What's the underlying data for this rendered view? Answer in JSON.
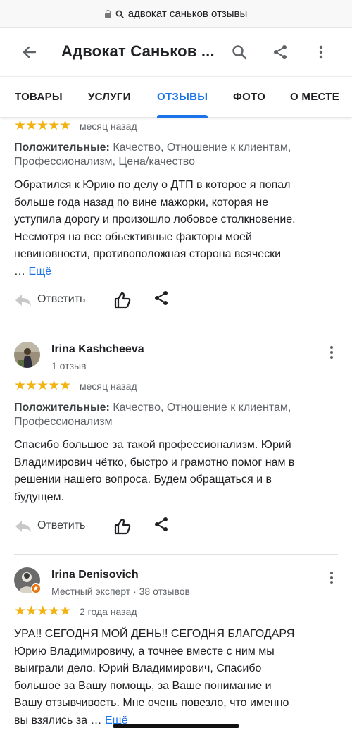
{
  "browser": {
    "url_text": "адвокат саньков отзывы"
  },
  "header": {
    "title": "Адвокат Саньков ..."
  },
  "tabs": [
    {
      "label": "ТОВАРЫ",
      "active": false
    },
    {
      "label": "УСЛУГИ",
      "active": false
    },
    {
      "label": "ОТЗЫВЫ",
      "active": true
    },
    {
      "label": "ФОТО",
      "active": false
    },
    {
      "label": "О МЕСТЕ",
      "active": false
    }
  ],
  "reviews": [
    {
      "rating": 5,
      "stars": "★★★★★",
      "date": "месяц назад",
      "positive_label": "Положительные:",
      "positive_lines": [
        "Качество, Отношение к клиентам,",
        "Профессионализм, Цена/качество"
      ],
      "text_lines": [
        "Обратился к Юрию по делу о ДТП в которое я попал",
        "больше года назад по вине мажорки, которая не",
        "уступила дорогу и произошло лобовое столкновение.",
        "Несмотря на все обьективные факторы моей",
        "невиновности, противоположная сторона всячески",
        "… "
      ],
      "more_label": "Ещё",
      "reply_label": "Ответить"
    },
    {
      "author": "Irina Kashcheeva",
      "author_meta": "1 отзыв",
      "rating": 5,
      "stars": "★★★★★",
      "date": "месяц назад",
      "positive_label": "Положительные:",
      "positive_lines": [
        "Качество, Отношение к клиентам,",
        "Профессионализм"
      ],
      "text_lines": [
        "Спасибо большое за такой профессионализм. Юрий",
        "Владимирович чётко, быстро и грамотно помог нам в",
        "решении нашего вопроса. Будем обращаться и в",
        "будущем."
      ],
      "reply_label": "Ответить"
    },
    {
      "author": "Irina Denisovich",
      "author_meta": "Местный эксперт · 38 отзывов",
      "rating": 5,
      "stars": "★★★★★",
      "date": "2 года назад",
      "text_lines": [
        "УРА!! СЕГОДНЯ МОЙ ДЕНЬ!! СЕГОДНЯ БЛАГОДАРЯ",
        "Юрию Владимировичу, а точнее вместе с ним мы",
        "выиграли дело. Юрий Владимирович, Спасибо",
        "большое за Вашу помощь, за Ваше понимание и",
        "Вашу отзывчивость. Мне очень повезло,  что именно",
        "вы взялись за … "
      ],
      "more_label": "Ещё"
    }
  ],
  "colors": {
    "accent": "#1a73e8",
    "star": "#f2b20f",
    "text": "#202124",
    "muted": "#5f6368"
  }
}
